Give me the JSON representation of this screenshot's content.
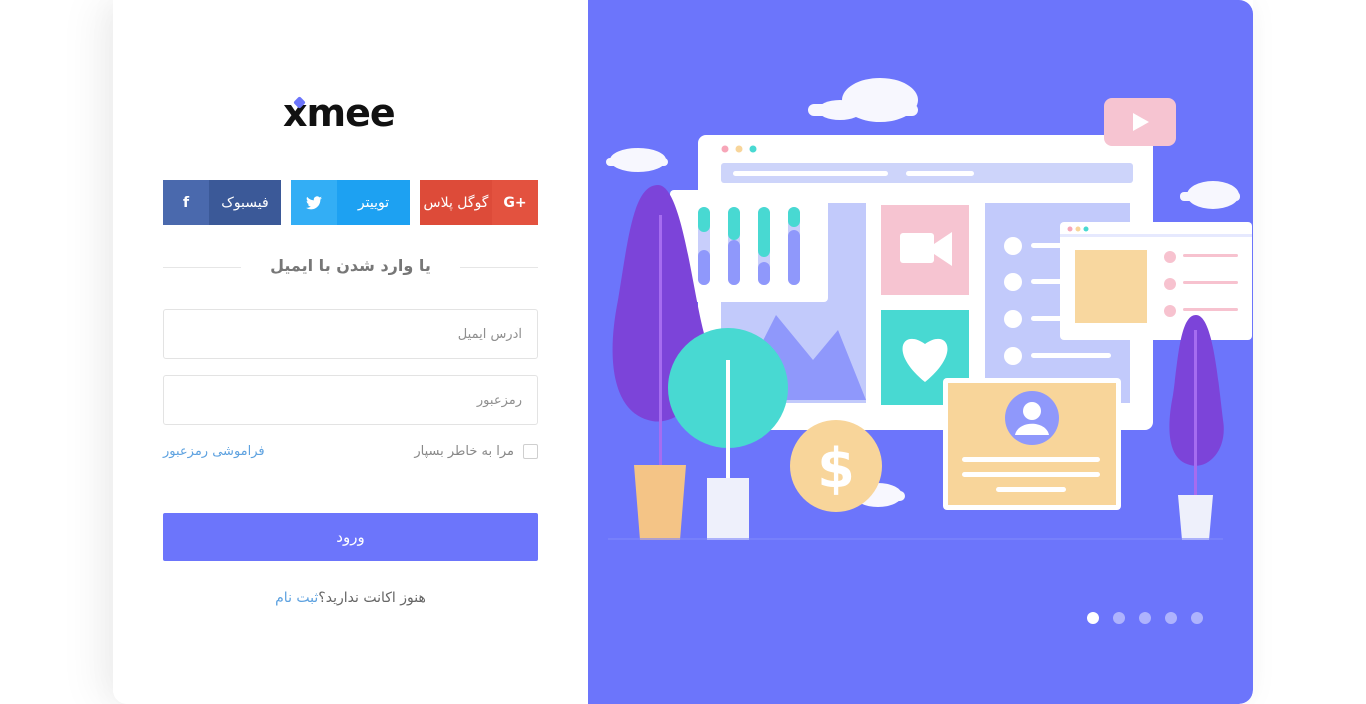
{
  "brand": {
    "logo_text": "xmee"
  },
  "social": {
    "facebook": {
      "label": "فیسبوک",
      "icon": "f"
    },
    "twitter": {
      "label": "توییتر",
      "icon": "t"
    },
    "googleplus": {
      "label": "گوگل پلاس",
      "icon": "G+"
    }
  },
  "divider_text": "یا وارد شدن با ایمیل",
  "form": {
    "email_placeholder": "آدرس ایمیل",
    "password_placeholder": "رمزعبور",
    "remember_label": "مرا به خاطر بسپار",
    "forgot_label": "فراموشی رمزعبور",
    "submit_label": "ورود"
  },
  "signup": {
    "prompt": "هنوز اکانت ندارید؟",
    "link_label": "ثبت نام"
  },
  "carousel": {
    "slide_count": 5,
    "active_index": 0
  },
  "colors": {
    "accent": "#6c75fb",
    "facebook": "#3b5998",
    "twitter": "#1da1f2",
    "googleplus": "#dd4b39",
    "link": "#5ea2e0"
  }
}
